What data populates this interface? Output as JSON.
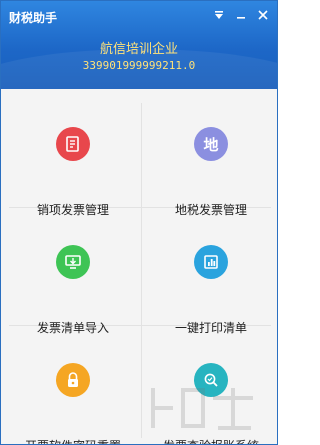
{
  "app": {
    "title": "财税助手",
    "company_name": "航信培训企业",
    "tax_id": "339901999999211.0"
  },
  "window_controls": {
    "menu_icon": "menu-down-icon",
    "minimize_icon": "minimize-icon",
    "close_icon": "close-icon"
  },
  "tiles": [
    {
      "label": "销项发票管理",
      "icon": "invoice-document-icon",
      "color": "#e8474c"
    },
    {
      "label": "地税发票管理",
      "icon": "local-tax-icon",
      "icon_text": "地",
      "color": "#8b8fe0"
    },
    {
      "label": "发票清单导入",
      "icon": "import-monitor-icon",
      "color": "#3ec455"
    },
    {
      "label": "一键打印清单",
      "icon": "print-chart-icon",
      "color": "#2aa3de"
    },
    {
      "label": "开票软件密码重置",
      "icon": "lock-icon",
      "color": "#f5a623"
    },
    {
      "label": "发票查验报账系统",
      "icon": "search-verify-icon",
      "color": "#27b4c0"
    }
  ],
  "colors": {
    "header_top": "#2f86e0",
    "header_bottom": "#1a5fbc",
    "company_text": "#ffe27a"
  }
}
